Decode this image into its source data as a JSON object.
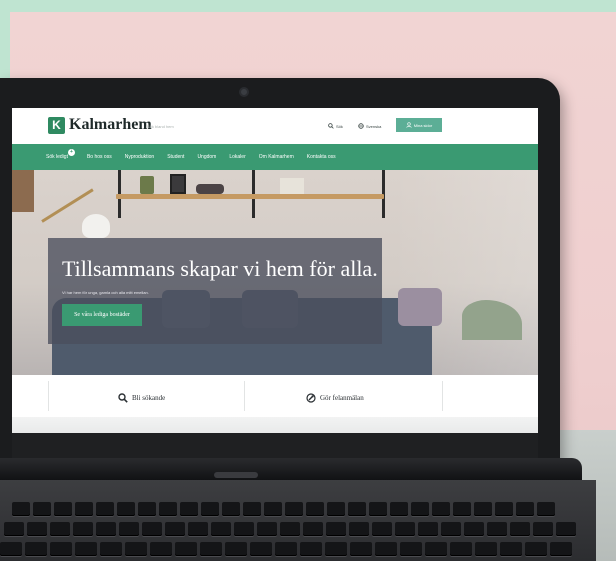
{
  "site": {
    "logo_letter": "K",
    "name": "Kalmarhem",
    "search_placeholder": "Sök bland hem",
    "top_links": [
      {
        "label": "Sök",
        "icon": "search-icon"
      },
      {
        "label": "Svenska",
        "icon": "globe-icon"
      }
    ],
    "login_label": "Mina sidor"
  },
  "nav": {
    "items": [
      {
        "label": "Sök ledigt",
        "badge": "+"
      },
      {
        "label": "Bo hos oss"
      },
      {
        "label": "Nyproduktion"
      },
      {
        "label": "Student"
      },
      {
        "label": "Ungdom"
      },
      {
        "label": "Lokaler"
      },
      {
        "label": "Om Kalmarhem"
      },
      {
        "label": "Kontakta oss"
      }
    ]
  },
  "hero": {
    "title": "Tillsammans skapar vi hem för alla.",
    "subtitle": "Vi har hem för unga, gamla och alla mitt emellan.",
    "button_label": "Se våra lediga bostäder"
  },
  "quick_actions": [
    {
      "label": "Bli sökande",
      "icon": "search-icon"
    },
    {
      "label": "Gör felanmälan",
      "icon": "wrench-icon"
    }
  ],
  "colors": {
    "brand_green": "#3a9a72",
    "logo_green": "#2f8a61",
    "login_green": "#5cae96",
    "hero_overlay": "#4a4e5c",
    "frame_mint": "#bfe4d1"
  }
}
